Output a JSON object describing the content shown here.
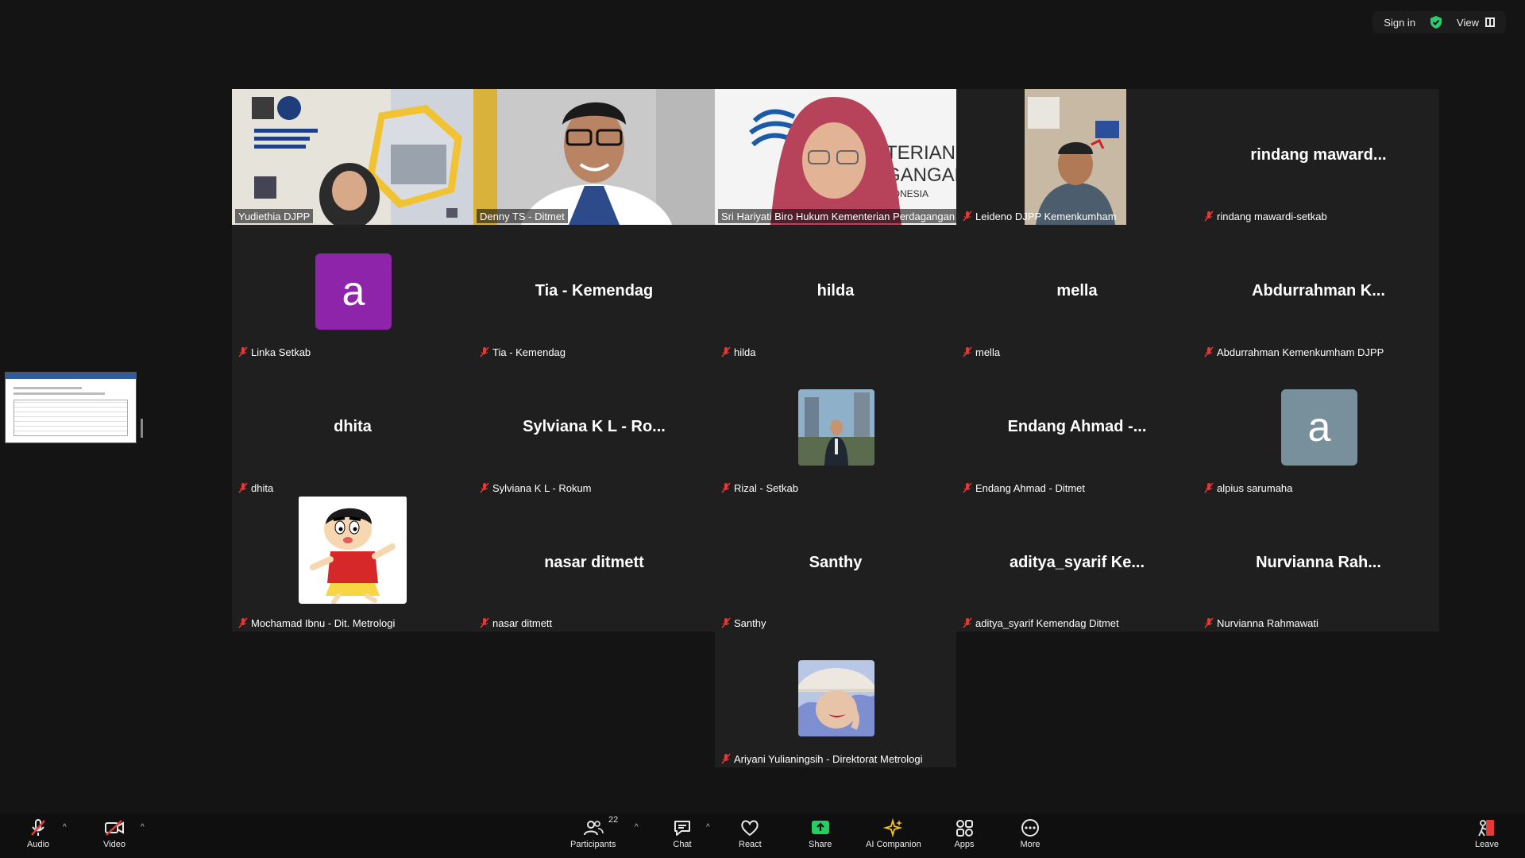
{
  "topbar": {
    "sign_in": "Sign in",
    "view": "View"
  },
  "tiles": [
    {
      "name": "Yudiethia DJPP",
      "kind": "video"
    },
    {
      "name": "Denny TS - Ditmet",
      "kind": "video",
      "active": true
    },
    {
      "name": "Sri Hariyati Biro Hukum Kementerian Perdagangan",
      "kind": "video"
    },
    {
      "name": "Leideno DJPP Kemenkumham",
      "kind": "video"
    },
    {
      "name": "rindang mawardi-setkab",
      "display": "rindang maward...",
      "kind": "name"
    },
    {
      "name": "Linka Setkab",
      "kind": "avatar",
      "letter": "a",
      "color": "#8e24aa"
    },
    {
      "name": "Tia - Kemendag",
      "display": "Tia - Kemendag",
      "kind": "name"
    },
    {
      "name": "hilda",
      "display": "hilda",
      "kind": "name"
    },
    {
      "name": "mella",
      "display": "mella",
      "kind": "name"
    },
    {
      "name": "Abdurrahman Kemenkumham DJPP",
      "display": "Abdurrahman K...",
      "kind": "name"
    },
    {
      "name": "dhita",
      "display": "dhita",
      "kind": "name"
    },
    {
      "name": "Sylviana K L - Rokum",
      "display": "Sylviana K L - Ro...",
      "kind": "name"
    },
    {
      "name": "Rizal - Setkab",
      "kind": "photo"
    },
    {
      "name": "Endang Ahmad - Ditmet",
      "display": "Endang Ahmad -...",
      "kind": "name"
    },
    {
      "name": "alpius sarumaha",
      "kind": "avatar",
      "letter": "a",
      "color": "#78909c"
    },
    {
      "name": "Mochamad Ibnu - Dit. Metrologi",
      "kind": "cartoon"
    },
    {
      "name": "nasar ditmett",
      "display": "nasar ditmett",
      "kind": "name"
    },
    {
      "name": "Santhy",
      "display": "Santhy",
      "kind": "name"
    },
    {
      "name": "aditya_syarif Kemendag Ditmet",
      "display": "aditya_syarif Ke...",
      "kind": "name"
    },
    {
      "name": "Nurvianna Rahmawati",
      "display": "Nurvianna Rah...",
      "kind": "name"
    },
    {
      "name": "Ariyani Yulianingsih - Direktorat Metrologi",
      "kind": "photo2"
    }
  ],
  "toolbar": {
    "audio": "Audio",
    "video": "Video",
    "participants": "Participants",
    "participants_count": "22",
    "chat": "Chat",
    "react": "React",
    "share": "Share",
    "ai_companion": "AI Companion",
    "apps": "Apps",
    "more": "More",
    "leave": "Leave"
  },
  "colors": {
    "accent_green": "#2ecc71",
    "muted_red": "#e53935",
    "share_green": "#23d160"
  }
}
